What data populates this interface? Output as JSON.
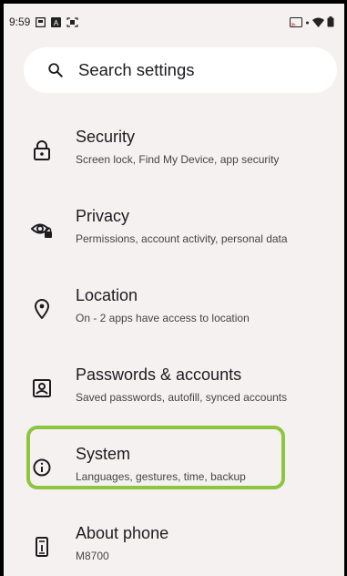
{
  "statusbar": {
    "time": "9:59"
  },
  "search": {
    "placeholder": "Search settings"
  },
  "items": [
    {
      "title": "Security",
      "subtitle": "Screen lock, Find My Device, app security",
      "icon": "lock-icon"
    },
    {
      "title": "Privacy",
      "subtitle": "Permissions, account activity, personal data",
      "icon": "privacy-eye-lock-icon"
    },
    {
      "title": "Location",
      "subtitle": "On - 2 apps have access to location",
      "icon": "location-pin-icon"
    },
    {
      "title": "Passwords & accounts",
      "subtitle": "Saved passwords, autofill, synced accounts",
      "icon": "account-box-icon"
    },
    {
      "title": "System",
      "subtitle": "Languages, gestures, time, backup",
      "icon": "info-icon"
    },
    {
      "title": "About phone",
      "subtitle": "M8700",
      "icon": "phone-icon"
    }
  ],
  "highlight_color": "#8cc63f"
}
